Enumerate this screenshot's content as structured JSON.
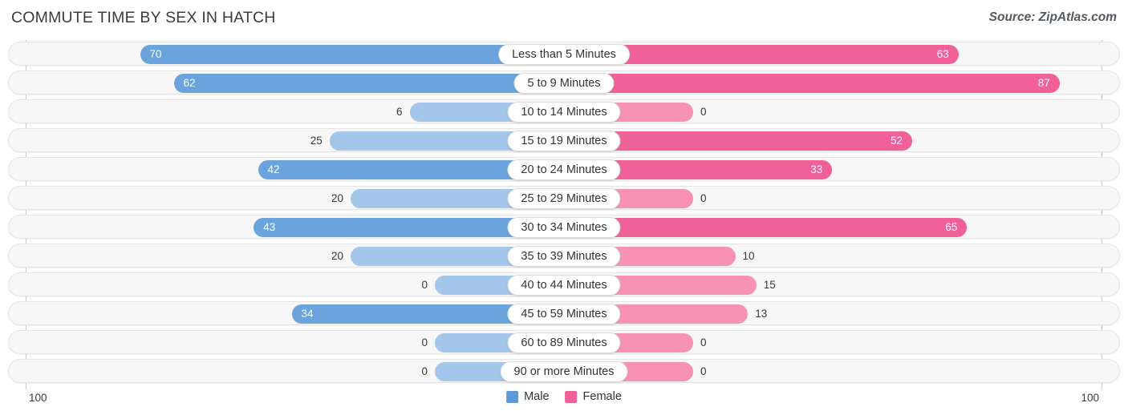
{
  "header": {
    "title": "COMMUTE TIME BY SEX IN HATCH",
    "source": "Source: ZipAtlas.com"
  },
  "axis": {
    "left_tick": "100",
    "right_tick": "100"
  },
  "legend": {
    "items": [
      {
        "label": "Male",
        "color": "#5B9BD5"
      },
      {
        "label": "Female",
        "color": "#F0619A"
      }
    ]
  },
  "colors": {
    "male_strong": "#6BA3DC",
    "male_light": "#A3C6EA",
    "female_strong": "#F0619A",
    "female_light": "#F792B5",
    "row_bg": "#f7f7f7",
    "row_border": "#e4e4e4"
  },
  "chart_data": {
    "type": "bar",
    "orientation": "horizontal-diverging",
    "title": "COMMUTE TIME BY SEX IN HATCH",
    "xlabel": "",
    "ylabel": "",
    "xlim": [
      100,
      100
    ],
    "grid": false,
    "legend_position": "bottom-center",
    "categories": [
      "Less than 5 Minutes",
      "5 to 9 Minutes",
      "10 to 14 Minutes",
      "15 to 19 Minutes",
      "20 to 24 Minutes",
      "25 to 29 Minutes",
      "30 to 34 Minutes",
      "35 to 39 Minutes",
      "40 to 44 Minutes",
      "45 to 59 Minutes",
      "60 to 89 Minutes",
      "90 or more Minutes"
    ],
    "series": [
      {
        "name": "Male",
        "values": [
          70,
          62,
          6,
          25,
          42,
          20,
          43,
          20,
          0,
          34,
          0,
          0
        ]
      },
      {
        "name": "Female",
        "values": [
          63,
          87,
          0,
          52,
          33,
          0,
          65,
          10,
          15,
          13,
          0,
          0
        ]
      }
    ]
  },
  "rows": [
    {
      "label": "Less than 5 Minutes",
      "male": "70",
      "female": "63"
    },
    {
      "label": "5 to 9 Minutes",
      "male": "62",
      "female": "87"
    },
    {
      "label": "10 to 14 Minutes",
      "male": "6",
      "female": "0"
    },
    {
      "label": "15 to 19 Minutes",
      "male": "25",
      "female": "52"
    },
    {
      "label": "20 to 24 Minutes",
      "male": "42",
      "female": "33"
    },
    {
      "label": "25 to 29 Minutes",
      "male": "20",
      "female": "0"
    },
    {
      "label": "30 to 34 Minutes",
      "male": "43",
      "female": "65"
    },
    {
      "label": "35 to 39 Minutes",
      "male": "20",
      "female": "10"
    },
    {
      "label": "40 to 44 Minutes",
      "male": "0",
      "female": "15"
    },
    {
      "label": "45 to 59 Minutes",
      "male": "34",
      "female": "13"
    },
    {
      "label": "60 to 89 Minutes",
      "male": "0",
      "female": "0"
    },
    {
      "label": "90 or more Minutes",
      "male": "0",
      "female": "0"
    }
  ]
}
